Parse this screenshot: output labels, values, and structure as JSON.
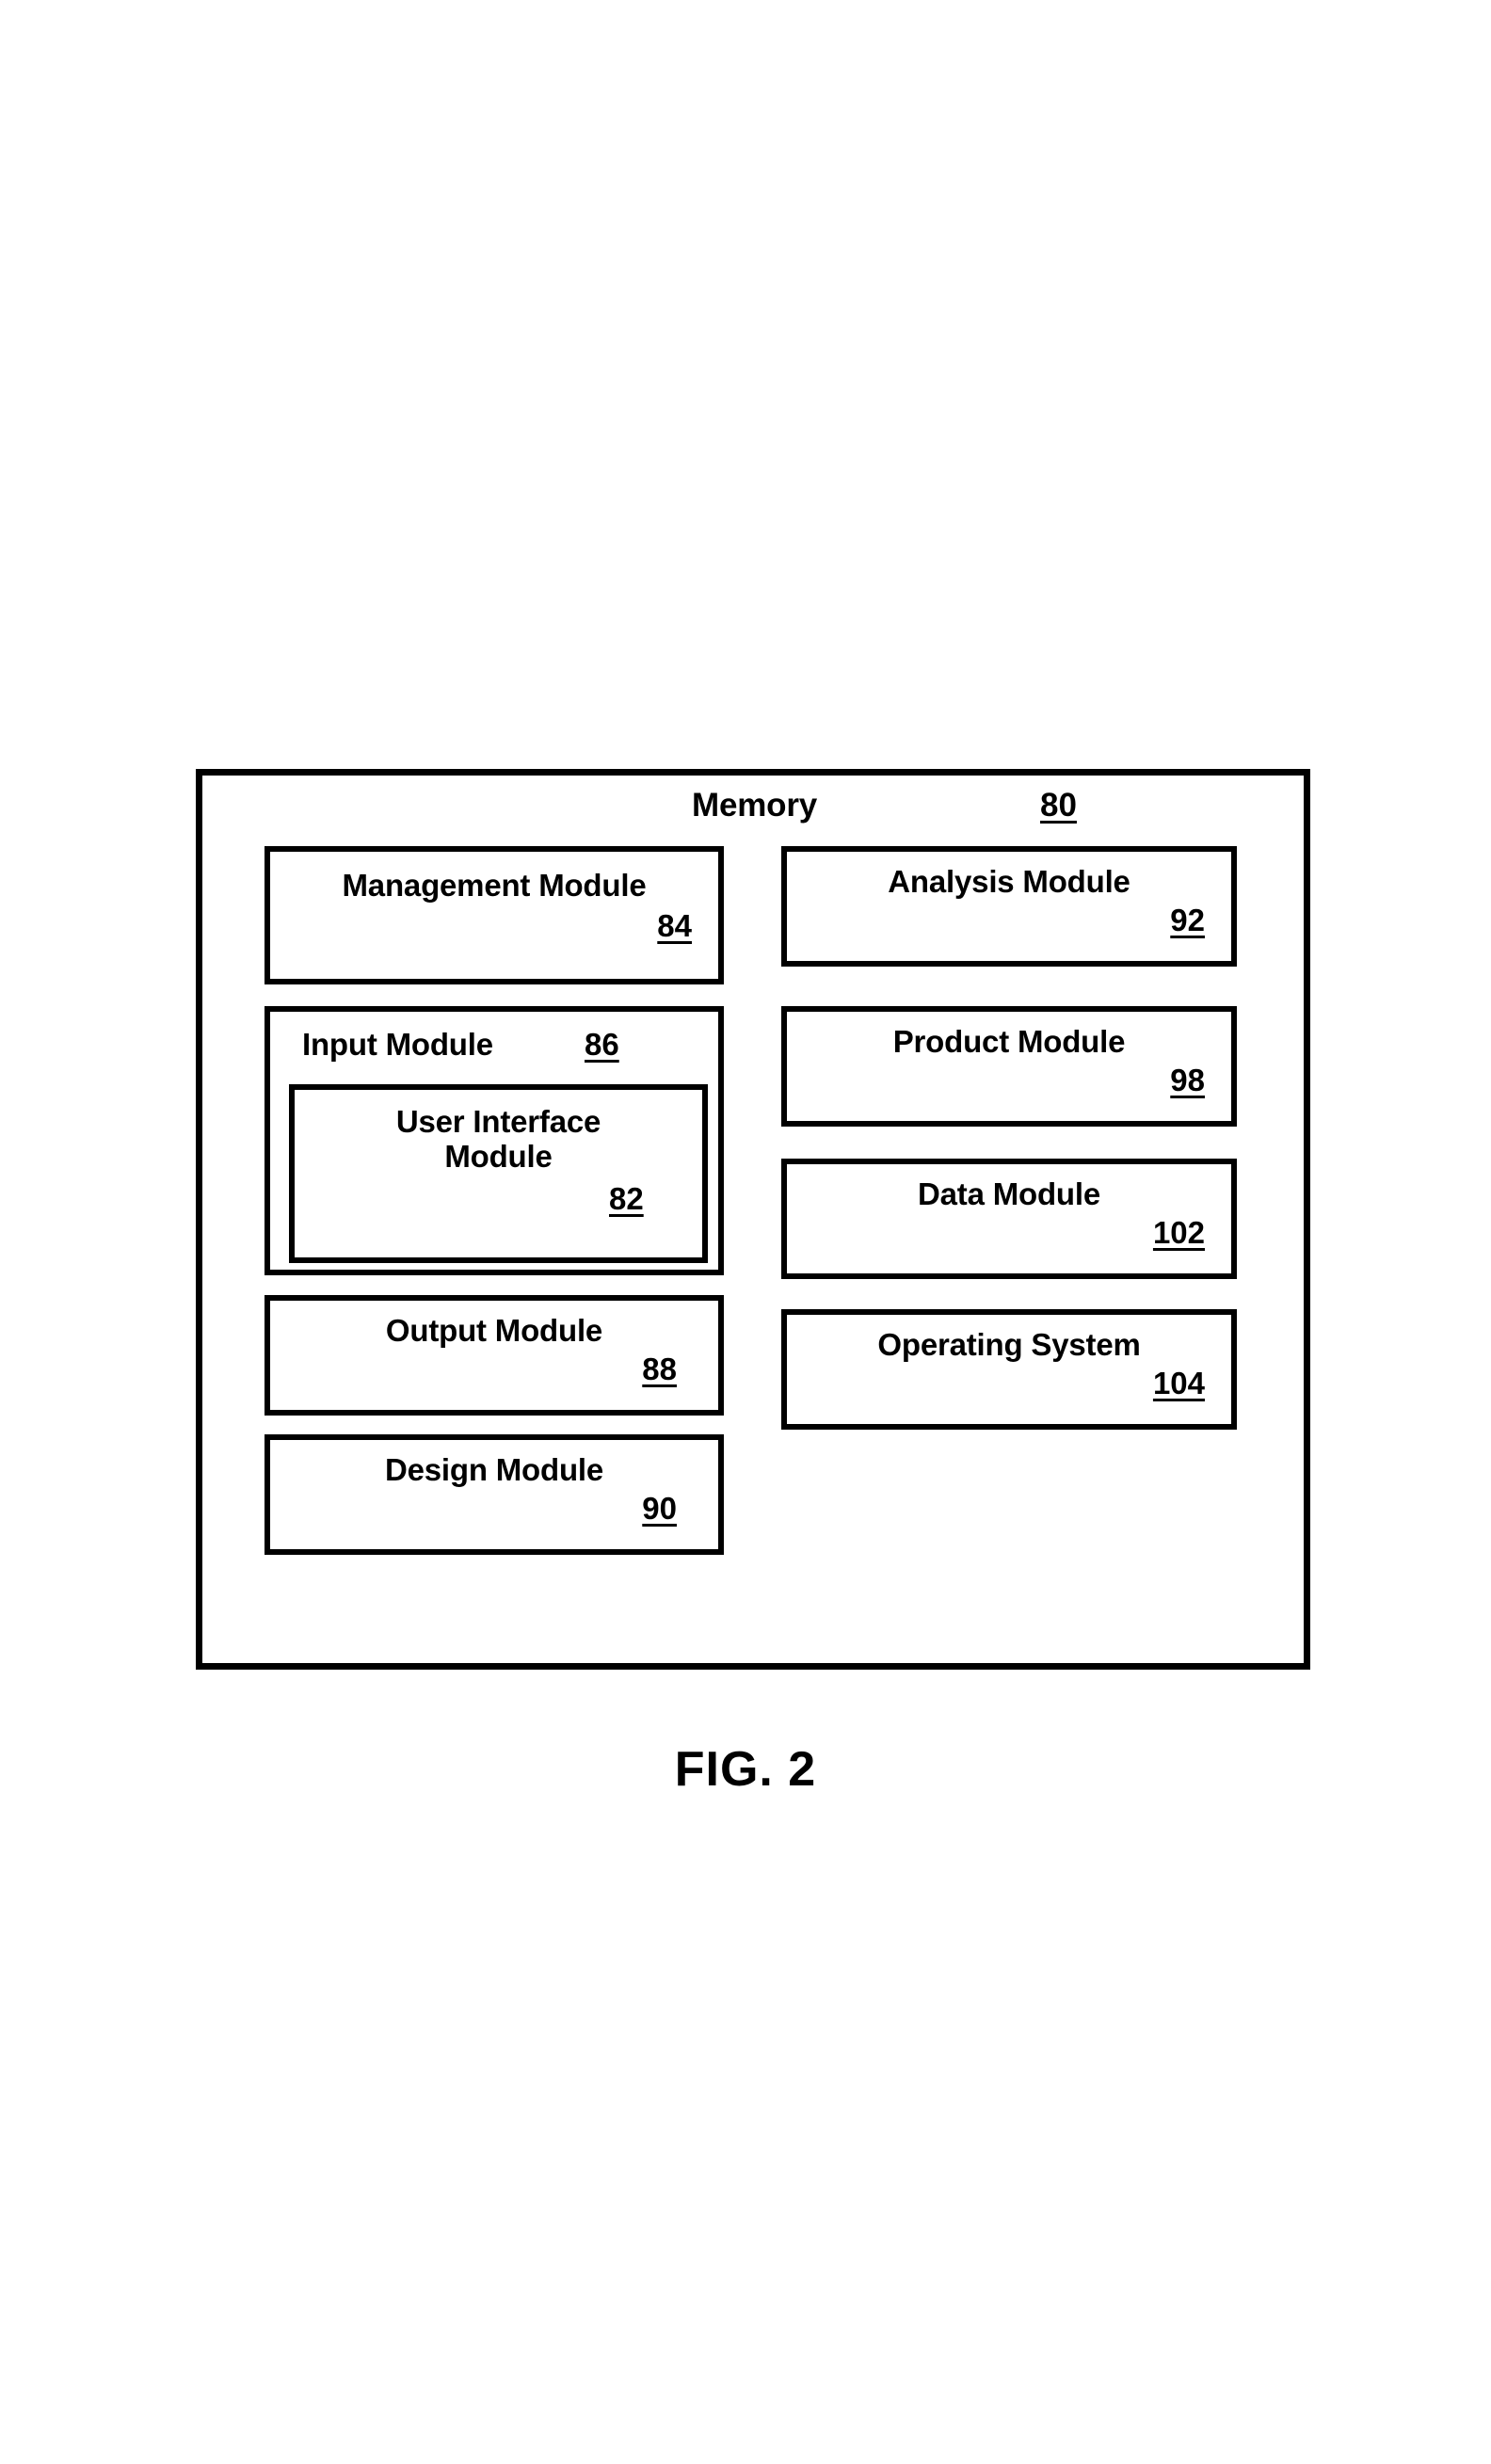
{
  "figure": {
    "caption": "FIG. 2"
  },
  "memory": {
    "title": "Memory",
    "reference_numeral": "80",
    "left_column": [
      {
        "label": "Management Module",
        "reference_numeral": "84",
        "layout": "stacked"
      },
      {
        "label": "Input Module",
        "reference_numeral": "86",
        "layout": "inline",
        "nested": {
          "label_line1": "User Interface",
          "label_line2": "Module",
          "reference_numeral": "82"
        }
      },
      {
        "label": "Output Module",
        "reference_numeral": "88",
        "layout": "stacked"
      },
      {
        "label": "Design Module",
        "reference_numeral": "90",
        "layout": "stacked"
      }
    ],
    "right_column": [
      {
        "label": "Analysis Module",
        "reference_numeral": "92",
        "layout": "stacked"
      },
      {
        "label": "Product Module",
        "reference_numeral": "98",
        "layout": "stacked"
      },
      {
        "label": "Data Module",
        "reference_numeral": "102",
        "layout": "stacked"
      },
      {
        "label": "Operating System",
        "reference_numeral": "104",
        "layout": "stacked"
      }
    ]
  },
  "colors": {
    "line": "#000000",
    "background": "#ffffff"
  }
}
